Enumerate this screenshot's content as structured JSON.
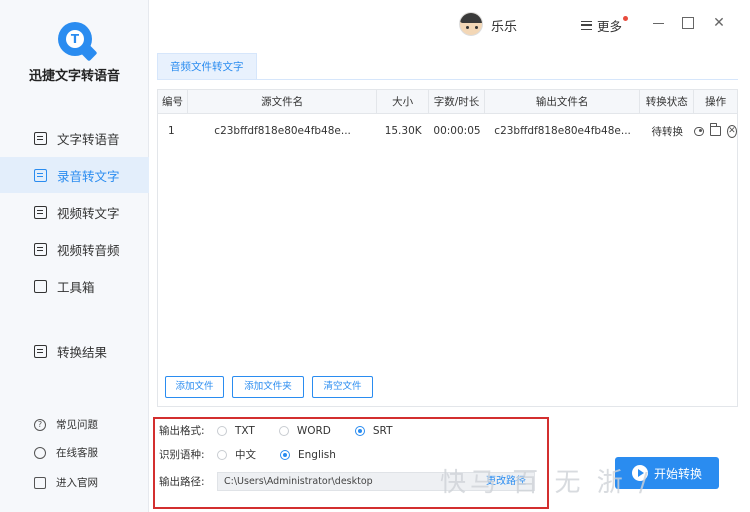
{
  "app": {
    "name": "迅捷文字转语音"
  },
  "sidebar": {
    "items": [
      {
        "label": "文字转语音"
      },
      {
        "label": "录音转文字"
      },
      {
        "label": "视频转文字"
      },
      {
        "label": "视频转音频"
      },
      {
        "label": "工具箱"
      },
      {
        "label": "转换结果"
      }
    ],
    "active_index": 1,
    "footer": [
      {
        "label": "常见问题"
      },
      {
        "label": "在线客服"
      },
      {
        "label": "进入官网"
      }
    ]
  },
  "header": {
    "username": "乐乐",
    "more_label": "更多",
    "close_symbol": "✕"
  },
  "tab": {
    "label": "音频文件转文字"
  },
  "table": {
    "columns": [
      "编号",
      "源文件名",
      "大小",
      "字数/时长",
      "输出文件名",
      "转换状态",
      "操作"
    ],
    "rows": [
      {
        "index": "1",
        "source": "c23bffdf818e80e4fb48e...",
        "size": "15.30K",
        "duration": "00:00:05",
        "output": "c23bffdf818e80e4fb48e...",
        "status": "待转换"
      }
    ]
  },
  "buttons": {
    "add_file": "添加文件",
    "add_folder": "添加文件夹",
    "clear_files": "清空文件"
  },
  "settings": {
    "format_label": "输出格式:",
    "formats": [
      "TXT",
      "WORD",
      "SRT"
    ],
    "format_selected": "SRT",
    "language_label": "识别语种:",
    "languages": [
      "中文",
      "English"
    ],
    "language_selected": "English",
    "path_label": "输出路径:",
    "path_value": "C:\\Users\\Administrator\\desktop",
    "change_label": "更改路径"
  },
  "start_button": {
    "label": "开始转换"
  },
  "watermark": {
    "text": "快马 百 无 浙 /"
  },
  "colors": {
    "accent": "#2a8cf0",
    "highlight_border": "#d32f2f"
  }
}
